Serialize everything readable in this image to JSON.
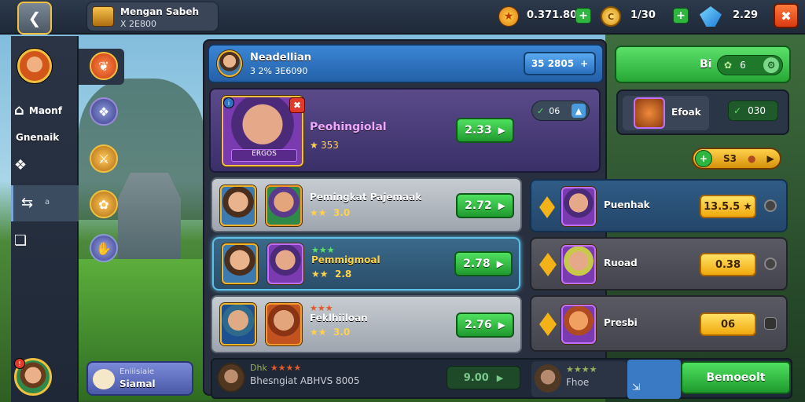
{
  "header": {
    "title": "Mengan Sabeh",
    "subtitle": "X 2E800",
    "gold_value": "0.371.80",
    "coin_value": "1/30",
    "gem_value": "2.29"
  },
  "sidebar": {
    "items": [
      {
        "label": "Maonf"
      },
      {
        "label": "Gnenaik"
      },
      {
        "label": ""
      },
      {
        "label": "a"
      },
      {
        "label": ""
      }
    ],
    "bottom_card": {
      "line1": "Eniiisiaie",
      "line2": "Siamal"
    }
  },
  "main": {
    "player": {
      "name": "Neadellian",
      "sub": "3 2% 3E6090",
      "button": "35 2805"
    },
    "featured": {
      "name": "Peohingiolal",
      "rating": "353",
      "tag": "ERGOS",
      "button": "2.33",
      "mini": "06"
    },
    "rows": [
      {
        "name": "Pemingkat Pajemaak",
        "stars": "3.0",
        "button": "2.72",
        "selected": false
      },
      {
        "name": "Pemmigmoal",
        "stars": "2.8",
        "button": "2.78",
        "selected": true
      },
      {
        "name": "Feklhiiloan",
        "stars": "3.0",
        "button": "2.76",
        "selected": false
      }
    ]
  },
  "right": {
    "top_button": {
      "prefix": "Bi",
      "value": "6"
    },
    "item_card": {
      "label": "Efoak",
      "value": "030"
    },
    "plus_pill": {
      "value": "S3"
    },
    "rewards": [
      {
        "name": "Puenhak",
        "value": "13.5.5"
      },
      {
        "name": "Ruoad",
        "value": "0.38"
      },
      {
        "name": "Presbi",
        "value": "06"
      }
    ]
  },
  "footer": {
    "label": "Dhk",
    "text": "Bhesngiat ABHVS 8005",
    "value": "9.00",
    "card_label": "Fhoe",
    "action": "Bemoeolt"
  },
  "colors": {
    "accent_green": "#2fb641",
    "accent_yellow": "#f3b318",
    "panel": "#313b4e",
    "header_blue": "#2d74c4"
  }
}
